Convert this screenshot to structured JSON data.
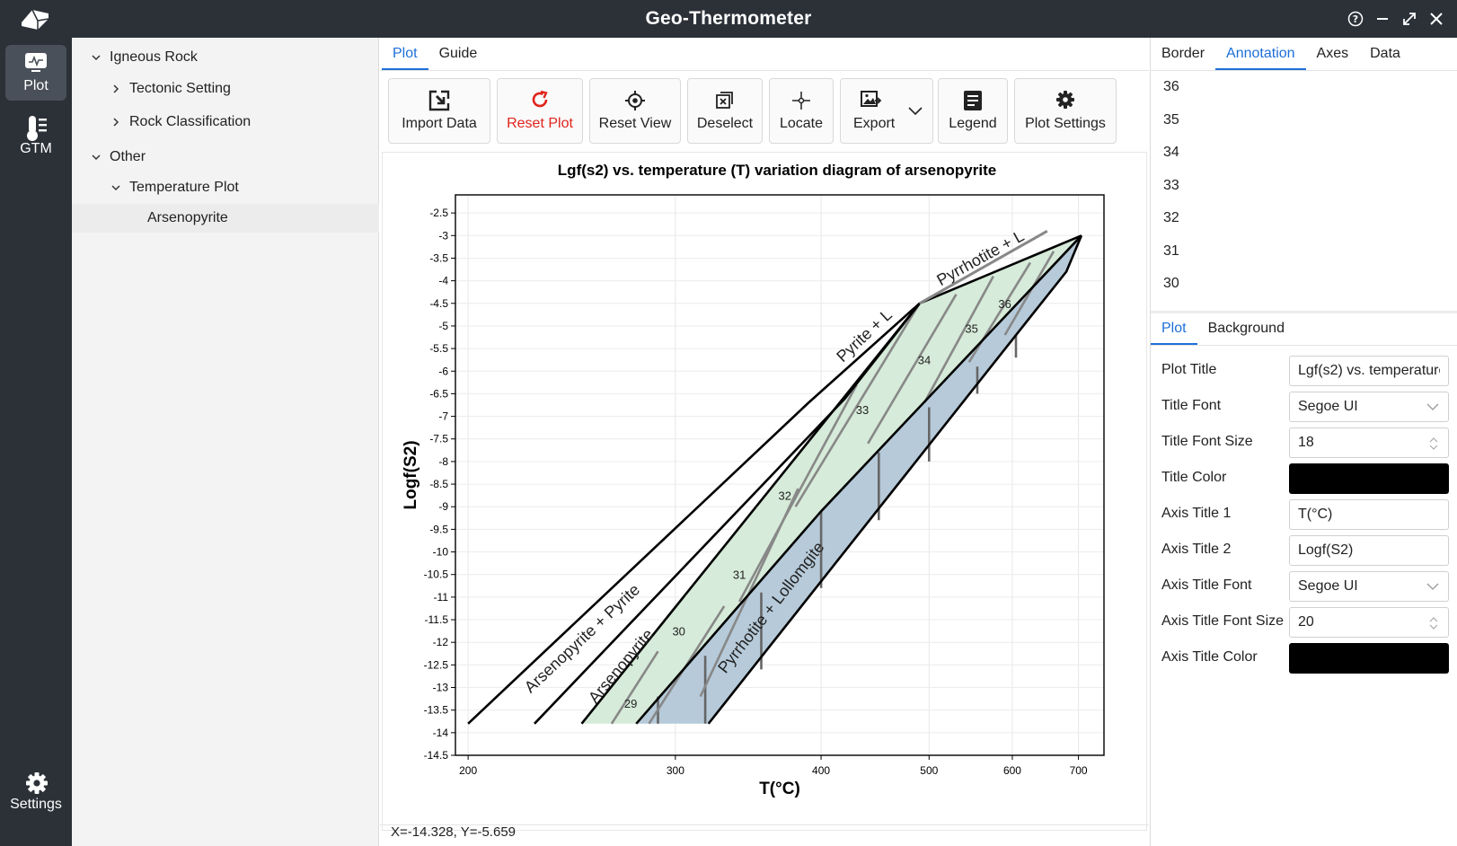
{
  "window": {
    "title": "Geo-Thermometer"
  },
  "navrail": {
    "items": [
      {
        "label": "Plot",
        "icon": "plot-icon",
        "active": true
      },
      {
        "label": "GTM",
        "icon": "thermometer-icon",
        "active": false
      }
    ],
    "settings_label": "Settings"
  },
  "tree": {
    "items": [
      {
        "label": "Igneous Rock",
        "level": 0,
        "expanded": true
      },
      {
        "label": "Tectonic Setting",
        "level": 1,
        "expanded": false
      },
      {
        "label": "Rock Classification",
        "level": 1,
        "expanded": false
      },
      {
        "label": "Other",
        "level": 0,
        "expanded": true
      },
      {
        "label": "Temperature Plot",
        "level": 1,
        "expanded": true
      },
      {
        "label": "Arsenopyrite",
        "level": 2,
        "selected": true
      }
    ]
  },
  "center": {
    "tabs": [
      {
        "label": "Plot",
        "active": true
      },
      {
        "label": "Guide",
        "active": false
      }
    ],
    "toolbar": {
      "import_data": "Import Data",
      "reset_plot": "Reset Plot",
      "reset_view": "Reset View",
      "deselect": "Deselect",
      "locate": "Locate",
      "export": "Export",
      "legend": "Legend",
      "plot_settings": "Plot Settings"
    },
    "status": "X=-14.328, Y=-5.659"
  },
  "colors": {
    "accent": "#1d6fd8",
    "danger": "#e0241b",
    "titlebar": "#2c3138",
    "green_field": "#d6ebd9",
    "blue_field": "#b6cad9"
  },
  "chart_data": {
    "type": "line",
    "title": "Lgf(s2) vs. temperature (T) variation diagram of arsenopyrite",
    "xlabel": "T(°C)",
    "ylabel": "Logf(S2)",
    "x_scale": "reciprocal",
    "xlim": [
      195,
      745
    ],
    "ylim": [
      -14.5,
      -2.1
    ],
    "x_ticks": [
      200,
      300,
      400,
      500,
      600,
      700
    ],
    "y_ticks": [
      -2.5,
      -3,
      -3.5,
      -4,
      -4.5,
      -5,
      -5.5,
      -6,
      -6.5,
      -7,
      -7.5,
      -8,
      -8.5,
      -9,
      -9.5,
      -10,
      -10.5,
      -11,
      -11.5,
      -12,
      -12.5,
      -13,
      -13.5,
      -14,
      -14.5
    ],
    "grid": true,
    "fields": [
      {
        "fill": "#d6ebd9",
        "points": [
          [
            250,
            -13.8
          ],
          [
            490,
            -4.5
          ],
          [
            705,
            -3.0
          ],
          [
            400,
            -9.1
          ],
          [
            278,
            -13.8
          ]
        ]
      },
      {
        "fill": "#b6cad9",
        "points": [
          [
            278,
            -13.8
          ],
          [
            400,
            -9.1
          ],
          [
            705,
            -3.0
          ],
          [
            680,
            -3.8
          ],
          [
            615,
            -5.0
          ],
          [
            320,
            -13.8
          ]
        ]
      }
    ],
    "lines": [
      {
        "name": "arsenopyrite-pyrite-boundary",
        "color": "#000000",
        "width": 2.6,
        "points": [
          [
            200,
            -13.8
          ],
          [
            390,
            -6.7
          ],
          [
            490,
            -4.5
          ]
        ]
      },
      {
        "name": "arsenopyrite-upper-boundary",
        "color": "#000000",
        "width": 2.6,
        "points": [
          [
            228,
            -13.8
          ],
          [
            420,
            -6.6
          ],
          [
            490,
            -4.5
          ]
        ]
      },
      {
        "name": "green-field-left-boundary",
        "color": "#000000",
        "width": 2.6,
        "points": [
          [
            250,
            -13.8
          ],
          [
            490,
            -4.5
          ]
        ]
      },
      {
        "name": "green-blue-boundary",
        "color": "#000000",
        "width": 2.6,
        "points": [
          [
            278,
            -13.8
          ],
          [
            400,
            -9.1
          ],
          [
            705,
            -3.0
          ]
        ]
      },
      {
        "name": "blue-field-right-boundary",
        "color": "#000000",
        "width": 2.6,
        "points": [
          [
            320,
            -13.8
          ],
          [
            615,
            -5.0
          ],
          [
            680,
            -3.8
          ],
          [
            705,
            -3.0
          ]
        ]
      },
      {
        "name": "pyrite-upper-boundary",
        "color": "#000000",
        "width": 2.6,
        "points": [
          [
            490,
            -4.5
          ],
          [
            705,
            -3.0
          ]
        ]
      },
      {
        "name": "pyrrhotite-liquid-line",
        "color": "#888888",
        "width": 3,
        "points": [
          [
            490,
            -4.5
          ],
          [
            650,
            -2.9
          ]
        ]
      }
    ],
    "isolines": [
      {
        "label": "29",
        "label_at": [
          275,
          -13.45
        ],
        "green": [
          [
            265,
            -13.8
          ],
          [
            290,
            -12.2
          ]
        ],
        "blue": [
          [
            290,
            -13.2
          ],
          [
            290,
            -13.8
          ]
        ]
      },
      {
        "label": "30",
        "label_at": [
          302,
          -11.85
        ],
        "green": [
          [
            285,
            -13.8
          ],
          [
            330,
            -11.2
          ]
        ],
        "blue": [
          [
            318,
            -12.3
          ],
          [
            318,
            -13.8
          ]
        ]
      },
      {
        "label": "31",
        "label_at": [
          340,
          -10.6
        ],
        "green": [
          [
            315,
            -13.2
          ],
          [
            382,
            -8.6
          ]
        ],
        "blue": [
          [
            355,
            -10.9
          ],
          [
            355,
            -12.6
          ]
        ]
      },
      {
        "label": "32",
        "label_at": [
          372,
          -8.85
        ],
        "green": [
          [
            340,
            -11.1
          ],
          [
            430,
            -6.3
          ]
        ],
        "blue": [
          [
            400,
            -9.1
          ],
          [
            400,
            -10.8
          ]
        ]
      },
      {
        "label": "33",
        "label_at": [
          435,
          -6.95
        ],
        "green": [
          [
            380,
            -9.0
          ],
          [
            490,
            -4.5
          ]
        ],
        "blue": [
          [
            450,
            -7.8
          ],
          [
            450,
            -9.3
          ]
        ]
      },
      {
        "label": "34",
        "label_at": [
          495,
          -5.85
        ],
        "green": [
          [
            440,
            -7.6
          ],
          [
            530,
            -4.3
          ]
        ],
        "blue": [
          [
            500,
            -6.8
          ],
          [
            500,
            -8.0
          ]
        ]
      },
      {
        "label": "35",
        "label_at": [
          548,
          -5.15
        ],
        "green": [
          [
            495,
            -6.7
          ],
          [
            575,
            -3.9
          ]
        ],
        "blue": [
          [
            555,
            -5.9
          ],
          [
            555,
            -6.5
          ]
        ]
      },
      {
        "label": "36",
        "label_at": [
          590,
          -4.6
        ],
        "green": [
          [
            545,
            -5.8
          ],
          [
            625,
            -3.6
          ]
        ],
        "blue": [
          [
            605,
            -5.2
          ],
          [
            605,
            -5.7
          ]
        ]
      },
      {
        "label": "",
        "green": [
          [
            590,
            -5.2
          ],
          [
            660,
            -3.35
          ]
        ],
        "blue": []
      }
    ],
    "annotations": [
      {
        "text": "Pyrite + L",
        "at": [
          440,
          -5.3
        ],
        "angle": -43
      },
      {
        "text": "Pyrrhotite + L",
        "at": [
          562,
          -3.6
        ],
        "angle": -29
      },
      {
        "text": "Arsenopyrite + Pyrite",
        "at": [
          252,
          -12.0
        ],
        "angle": -43
      },
      {
        "text": "Arsenopyrite",
        "at": [
          272,
          -12.6
        ],
        "angle": -50
      },
      {
        "text": "Pyrrhotite + Lollomgite",
        "at": [
          365,
          -11.3
        ],
        "angle": -52
      }
    ]
  },
  "right": {
    "tabs": [
      {
        "label": "Border",
        "active": false
      },
      {
        "label": "Annotation",
        "active": true
      },
      {
        "label": "Axes",
        "active": false
      },
      {
        "label": "Data",
        "active": false
      }
    ],
    "annotation_items": [
      "36",
      "35",
      "34",
      "33",
      "32",
      "31",
      "30"
    ],
    "sub_tabs": [
      {
        "label": "Plot",
        "active": true
      },
      {
        "label": "Background",
        "active": false
      }
    ],
    "props": {
      "plot_title_label": "Plot Title",
      "plot_title_value": "Lgf(s2) vs. temperature (T) variation diagram of arsenopyrite",
      "title_font_label": "Title Font",
      "title_font_value": "Segoe UI",
      "title_font_size_label": "Title Font Size",
      "title_font_size_value": "18",
      "title_color_label": "Title Color",
      "title_color_value": "#000000",
      "axis_title1_label": "Axis Title 1",
      "axis_title1_value": "T(°C)",
      "axis_title2_label": "Axis Title 2",
      "axis_title2_value": "Logf(S2)",
      "axis_title_font_label": "Axis Title Font",
      "axis_title_font_value": "Segoe UI",
      "axis_title_font_size_label": "Axis Title Font Size",
      "axis_title_font_size_value": "20",
      "axis_title_color_label": "Axis Title Color",
      "axis_title_color_value": "#000000"
    }
  }
}
